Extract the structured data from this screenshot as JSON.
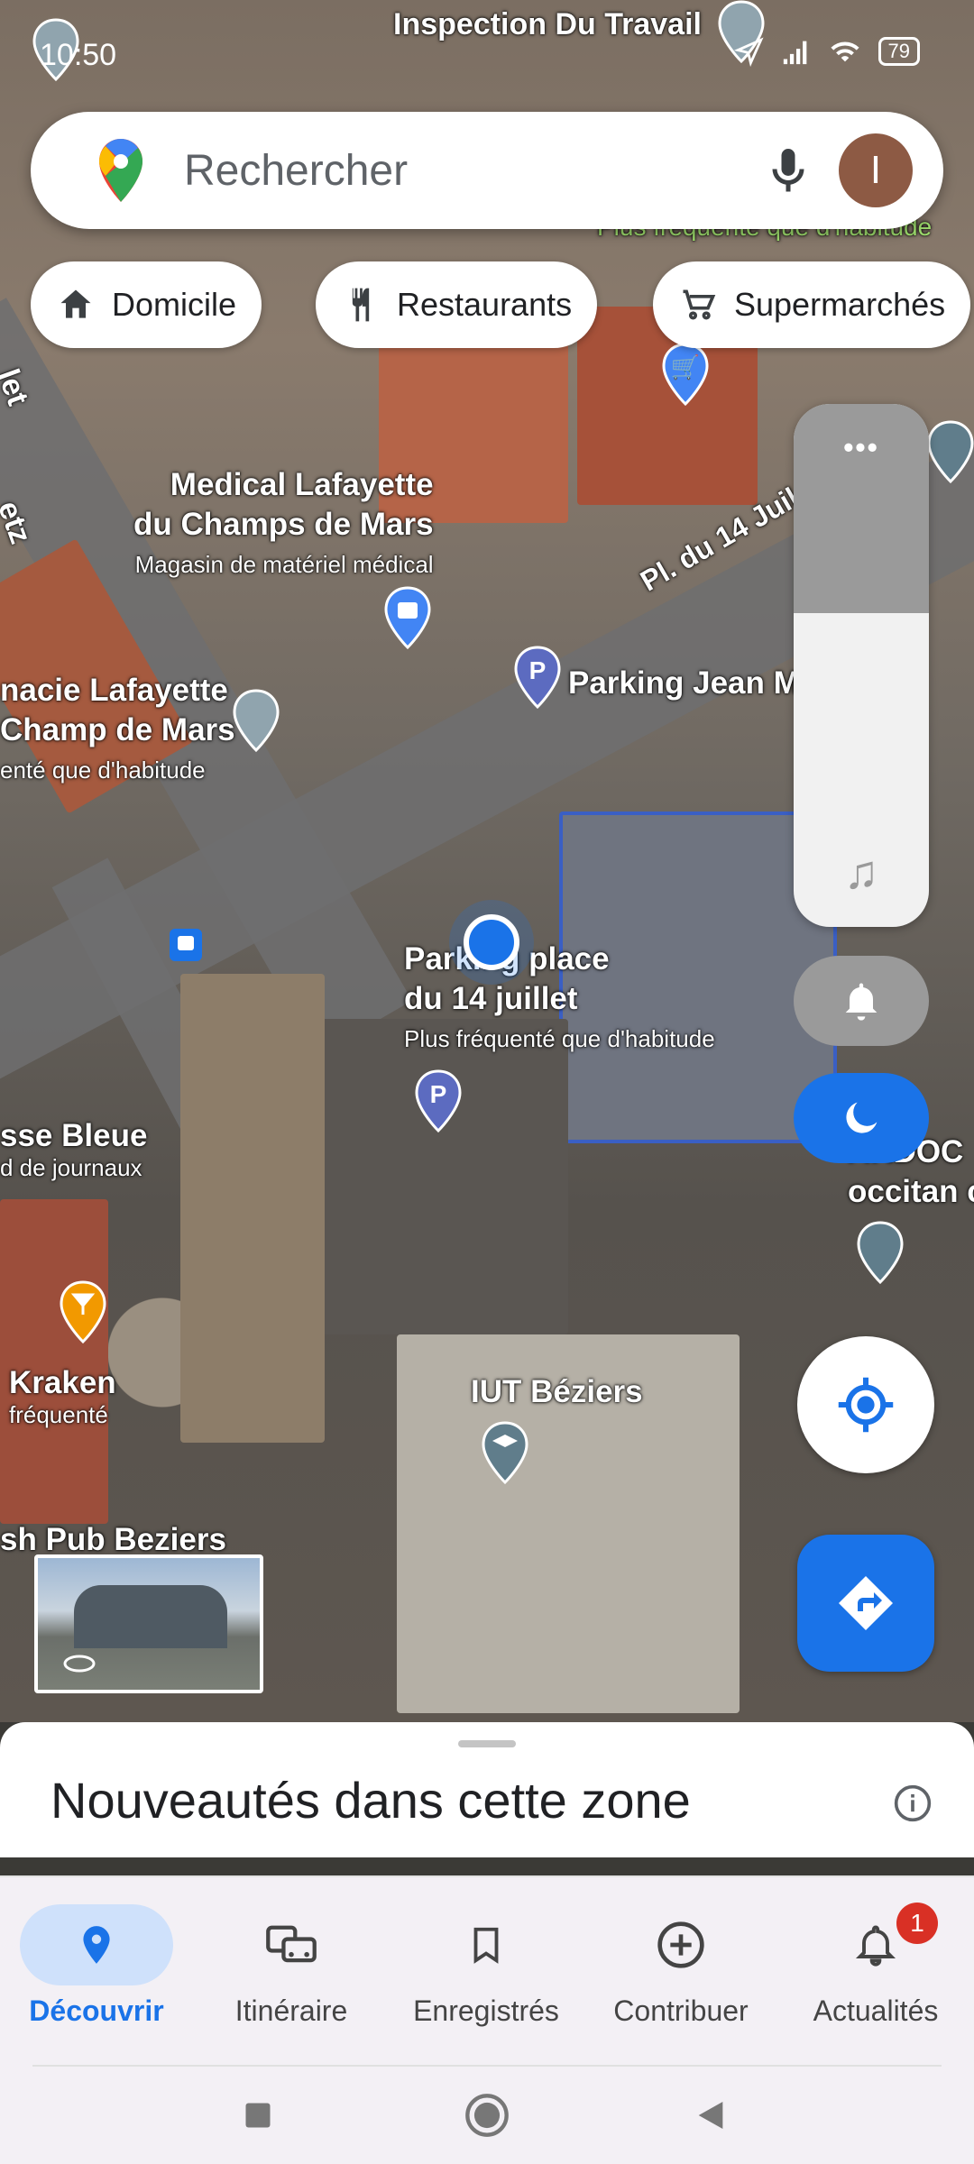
{
  "status_bar": {
    "time": "10:50",
    "battery": "79"
  },
  "search": {
    "placeholder": "Rechercher",
    "avatar_letter": "I"
  },
  "chips": [
    {
      "label": "Domicile",
      "icon": "home-icon"
    },
    {
      "label": "Restaurants",
      "icon": "restaurant-icon"
    },
    {
      "label": "Supermarchés",
      "icon": "cart-icon"
    }
  ],
  "map_labels": {
    "inspection": "Inspection Du Travail",
    "plus_frequente_top": "Plus fréquenté que d'habitude",
    "medical_name_1": "Medical Lafayette",
    "medical_name_2": "du Champs de Mars",
    "medical_sub": "Magasin de matériel médical",
    "place_14": "Pl. du 14 Juil",
    "parking_jean": "Parking Jean M",
    "pharmacie_1": "nacie Lafayette",
    "pharmacie_2": "Champ de Mars",
    "pharmacie_sub": "enté que d'habitude",
    "parking_place_1": "Parking place",
    "parking_place_2": "du 14 juillet",
    "parking_place_sub": "Plus fréquenté que d'habitude",
    "presse_1": "sse Bleue",
    "presse_sub": "d de journaux",
    "kraken_1": "Kraken",
    "kraken_sub": "fréquenté",
    "iut": "IUT Béziers",
    "pub": "sh Pub Beziers",
    "ardoc_1": "ARDOC",
    "ardoc_2": "occitan c",
    "etz": "etz",
    "let": "let"
  },
  "overlay": {
    "dots": "•••"
  },
  "sheet": {
    "title": "Nouveautés dans cette zone"
  },
  "nav": [
    {
      "label": "Découvrir",
      "icon": "explore-pin-icon",
      "active": true
    },
    {
      "label": "Itinéraire",
      "icon": "commute-icon"
    },
    {
      "label": "Enregistrés",
      "icon": "bookmark-icon"
    },
    {
      "label": "Contribuer",
      "icon": "add-circle-icon"
    },
    {
      "label": "Actualités",
      "icon": "bell-icon",
      "badge": "1"
    }
  ],
  "colors": {
    "accent": "#1a73e8",
    "badge": "#d93025",
    "active_pill": "#cfe1fb"
  }
}
